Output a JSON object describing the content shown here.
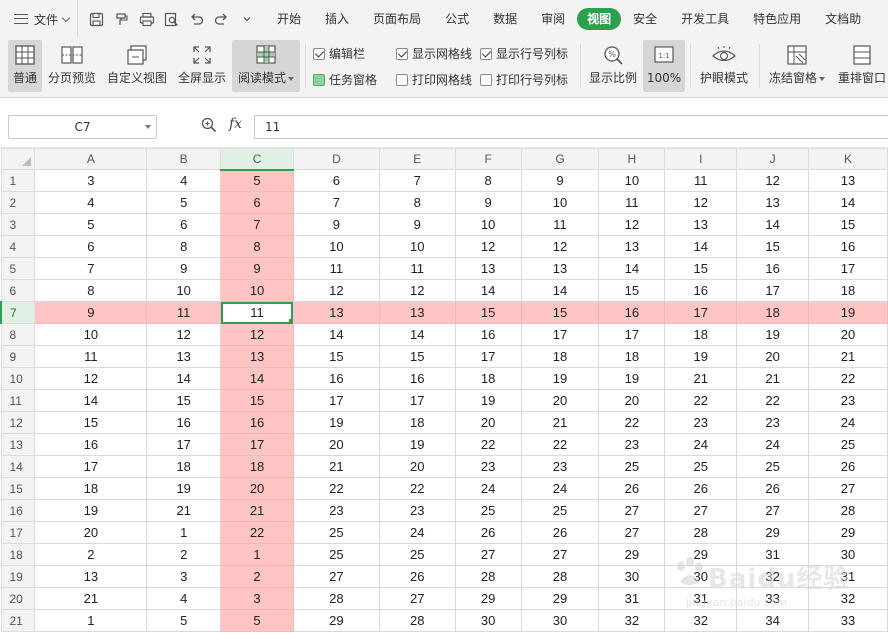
{
  "menubar": {
    "file_label": "文件",
    "tabs": [
      "开始",
      "插入",
      "页面布局",
      "公式",
      "数据",
      "审阅",
      "视图",
      "安全",
      "开发工具",
      "特色应用",
      "文档助"
    ],
    "active_tab": "视图"
  },
  "ribbon": {
    "normal": "普通",
    "page_break": "分页预览",
    "custom_view": "自定义视图",
    "fullscreen": "全屏显示",
    "reading_mode": "阅读模式",
    "edit_bar": "编辑栏",
    "task_pane": "任务窗格",
    "show_gridlines": "显示网格线",
    "print_gridlines": "打印网格线",
    "show_headers": "显示行号列标",
    "print_headers": "打印行号列标",
    "zoom": "显示比例",
    "zoom_100": "100%",
    "eye_mode": "护眼模式",
    "freeze": "冻结窗格",
    "arrange": "重排窗口"
  },
  "formula_bar": {
    "name_box": "C7",
    "fx": "fx",
    "value": "11"
  },
  "sheet": {
    "columns": [
      "A",
      "B",
      "C",
      "D",
      "E",
      "F",
      "G",
      "H",
      "I",
      "J",
      "K"
    ],
    "rows": [
      [
        3,
        4,
        5,
        6,
        7,
        8,
        9,
        10,
        11,
        12,
        13
      ],
      [
        4,
        5,
        6,
        7,
        8,
        9,
        10,
        11,
        12,
        13,
        14
      ],
      [
        5,
        6,
        7,
        9,
        9,
        10,
        11,
        12,
        13,
        14,
        15
      ],
      [
        6,
        8,
        8,
        10,
        10,
        12,
        12,
        13,
        14,
        15,
        16
      ],
      [
        7,
        9,
        9,
        11,
        11,
        13,
        13,
        14,
        15,
        16,
        17
      ],
      [
        8,
        10,
        10,
        12,
        12,
        14,
        14,
        15,
        16,
        17,
        18
      ],
      [
        9,
        11,
        11,
        13,
        13,
        15,
        15,
        16,
        17,
        18,
        19
      ],
      [
        10,
        12,
        12,
        14,
        14,
        16,
        17,
        17,
        18,
        19,
        20
      ],
      [
        11,
        13,
        13,
        15,
        15,
        17,
        18,
        18,
        19,
        20,
        21
      ],
      [
        12,
        14,
        14,
        16,
        16,
        18,
        19,
        19,
        21,
        21,
        22
      ],
      [
        14,
        15,
        15,
        17,
        17,
        19,
        20,
        20,
        22,
        22,
        23
      ],
      [
        15,
        16,
        16,
        19,
        18,
        20,
        21,
        22,
        23,
        23,
        24
      ],
      [
        16,
        17,
        17,
        20,
        19,
        22,
        22,
        23,
        24,
        24,
        25
      ],
      [
        17,
        18,
        18,
        21,
        20,
        23,
        23,
        25,
        25,
        25,
        26
      ],
      [
        18,
        19,
        20,
        22,
        22,
        24,
        24,
        26,
        26,
        26,
        27
      ],
      [
        19,
        21,
        21,
        23,
        23,
        25,
        25,
        27,
        27,
        27,
        28
      ],
      [
        20,
        1,
        22,
        25,
        24,
        26,
        26,
        27,
        28,
        29,
        29
      ],
      [
        2,
        2,
        1,
        25,
        25,
        27,
        27,
        29,
        29,
        31,
        30
      ],
      [
        13,
        3,
        2,
        27,
        26,
        28,
        28,
        30,
        30,
        32,
        31
      ],
      [
        21,
        4,
        3,
        28,
        27,
        29,
        29,
        31,
        31,
        33,
        32
      ],
      [
        1,
        5,
        5,
        29,
        28,
        30,
        30,
        32,
        32,
        34,
        33
      ]
    ],
    "active_row": 7,
    "active_col": "C"
  },
  "watermark": {
    "text": "Baidu经验",
    "sub": "jingyan.baidu.com"
  },
  "colors": {
    "accent": "#2e9e4f",
    "highlight": "#ffc4c4"
  }
}
